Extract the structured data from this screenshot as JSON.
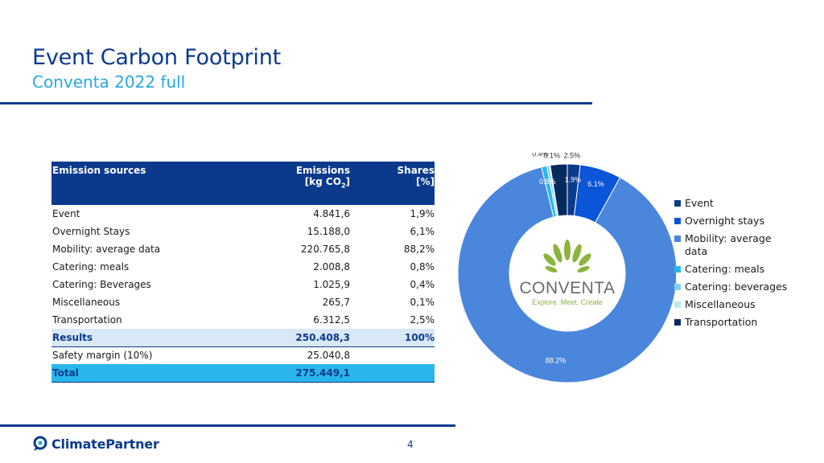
{
  "slide": {
    "title": "Event Carbon Footprint",
    "subtitle": "Conventa 2022 full",
    "page_number": "4"
  },
  "table": {
    "headers": {
      "source": "Emission sources",
      "emissions_line1": "Emissions",
      "emissions_line2_pre": "[kg CO",
      "emissions_sub": "2",
      "emissions_line2_post": "]",
      "shares_line1": "Shares",
      "shares_line2": "[%]"
    },
    "rows": [
      {
        "source": "Event",
        "emissions": "4.841,6",
        "share": "1,9%"
      },
      {
        "source": "Overnight Stays",
        "emissions": "15.188,0",
        "share": "6,1%"
      },
      {
        "source": "Mobility: average data",
        "emissions": "220.765,8",
        "share": "88,2%"
      },
      {
        "source": "Catering: meals",
        "emissions": "2.008,8",
        "share": "0,8%"
      },
      {
        "source": "Catering: Beverages",
        "emissions": "1.025,9",
        "share": "0,4%"
      },
      {
        "source": "Miscellaneous",
        "emissions": "265,7",
        "share": "0,1%"
      },
      {
        "source": "Transportation",
        "emissions": "6.312,5",
        "share": "2,5%"
      }
    ],
    "results": {
      "label": "Results",
      "emissions": "250.408,3",
      "share": "100%"
    },
    "safety": {
      "label": "Safety margin (10%)",
      "emissions": "25.040,8",
      "share": ""
    },
    "total": {
      "label": "Total",
      "emissions": "275.449,1",
      "share": ""
    }
  },
  "chart_data": {
    "type": "pie",
    "donut": true,
    "legend_position": "right",
    "categories": [
      "Event",
      "Overnight stays",
      "Mobility: average data",
      "Catering: meals",
      "Catering: beverages",
      "Miscellaneous",
      "Transportation"
    ],
    "values": [
      1.9,
      6.1,
      88.2,
      0.8,
      0.4,
      0.1,
      2.5
    ],
    "labels": [
      "1.9%",
      "6.1%",
      "88.2%",
      "0.8%",
      "0.4%",
      "0.1%",
      "2.5%"
    ],
    "colors": [
      "#0b3a8c",
      "#0a55d8",
      "#4a86dc",
      "#29b6ec",
      "#7dd3f0",
      "#bde6f5",
      "#072a5c"
    ]
  },
  "center_logo": {
    "name": "CONVENTA",
    "tagline": "Explore. Meet. Create"
  },
  "footer": {
    "brand": "ClimatePartner"
  },
  "colors": {
    "primary": "#0b3a8c",
    "accent": "#29a8e0",
    "logo_green": "#8cb33c"
  }
}
